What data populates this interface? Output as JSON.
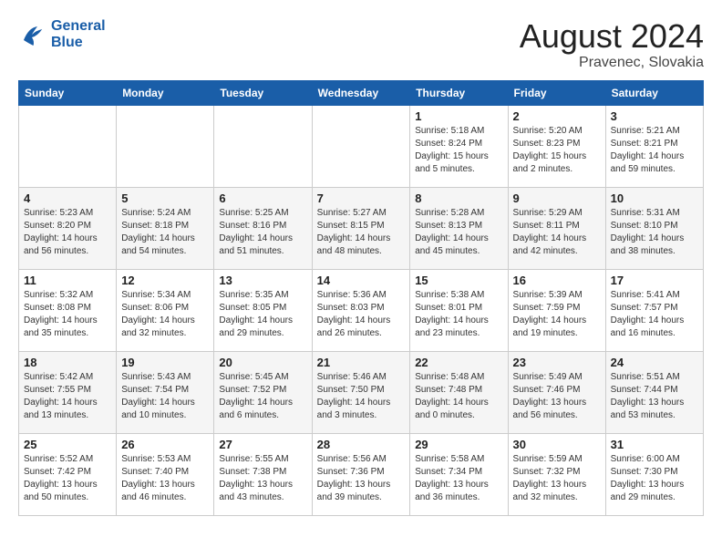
{
  "logo": {
    "line1": "General",
    "line2": "Blue"
  },
  "title": {
    "month_year": "August 2024",
    "location": "Pravenec, Slovakia"
  },
  "weekdays": [
    "Sunday",
    "Monday",
    "Tuesday",
    "Wednesday",
    "Thursday",
    "Friday",
    "Saturday"
  ],
  "weeks": [
    [
      {
        "day": "",
        "info": ""
      },
      {
        "day": "",
        "info": ""
      },
      {
        "day": "",
        "info": ""
      },
      {
        "day": "",
        "info": ""
      },
      {
        "day": "1",
        "info": "Sunrise: 5:18 AM\nSunset: 8:24 PM\nDaylight: 15 hours\nand 5 minutes."
      },
      {
        "day": "2",
        "info": "Sunrise: 5:20 AM\nSunset: 8:23 PM\nDaylight: 15 hours\nand 2 minutes."
      },
      {
        "day": "3",
        "info": "Sunrise: 5:21 AM\nSunset: 8:21 PM\nDaylight: 14 hours\nand 59 minutes."
      }
    ],
    [
      {
        "day": "4",
        "info": "Sunrise: 5:23 AM\nSunset: 8:20 PM\nDaylight: 14 hours\nand 56 minutes."
      },
      {
        "day": "5",
        "info": "Sunrise: 5:24 AM\nSunset: 8:18 PM\nDaylight: 14 hours\nand 54 minutes."
      },
      {
        "day": "6",
        "info": "Sunrise: 5:25 AM\nSunset: 8:16 PM\nDaylight: 14 hours\nand 51 minutes."
      },
      {
        "day": "7",
        "info": "Sunrise: 5:27 AM\nSunset: 8:15 PM\nDaylight: 14 hours\nand 48 minutes."
      },
      {
        "day": "8",
        "info": "Sunrise: 5:28 AM\nSunset: 8:13 PM\nDaylight: 14 hours\nand 45 minutes."
      },
      {
        "day": "9",
        "info": "Sunrise: 5:29 AM\nSunset: 8:11 PM\nDaylight: 14 hours\nand 42 minutes."
      },
      {
        "day": "10",
        "info": "Sunrise: 5:31 AM\nSunset: 8:10 PM\nDaylight: 14 hours\nand 38 minutes."
      }
    ],
    [
      {
        "day": "11",
        "info": "Sunrise: 5:32 AM\nSunset: 8:08 PM\nDaylight: 14 hours\nand 35 minutes."
      },
      {
        "day": "12",
        "info": "Sunrise: 5:34 AM\nSunset: 8:06 PM\nDaylight: 14 hours\nand 32 minutes."
      },
      {
        "day": "13",
        "info": "Sunrise: 5:35 AM\nSunset: 8:05 PM\nDaylight: 14 hours\nand 29 minutes."
      },
      {
        "day": "14",
        "info": "Sunrise: 5:36 AM\nSunset: 8:03 PM\nDaylight: 14 hours\nand 26 minutes."
      },
      {
        "day": "15",
        "info": "Sunrise: 5:38 AM\nSunset: 8:01 PM\nDaylight: 14 hours\nand 23 minutes."
      },
      {
        "day": "16",
        "info": "Sunrise: 5:39 AM\nSunset: 7:59 PM\nDaylight: 14 hours\nand 19 minutes."
      },
      {
        "day": "17",
        "info": "Sunrise: 5:41 AM\nSunset: 7:57 PM\nDaylight: 14 hours\nand 16 minutes."
      }
    ],
    [
      {
        "day": "18",
        "info": "Sunrise: 5:42 AM\nSunset: 7:55 PM\nDaylight: 14 hours\nand 13 minutes."
      },
      {
        "day": "19",
        "info": "Sunrise: 5:43 AM\nSunset: 7:54 PM\nDaylight: 14 hours\nand 10 minutes."
      },
      {
        "day": "20",
        "info": "Sunrise: 5:45 AM\nSunset: 7:52 PM\nDaylight: 14 hours\nand 6 minutes."
      },
      {
        "day": "21",
        "info": "Sunrise: 5:46 AM\nSunset: 7:50 PM\nDaylight: 14 hours\nand 3 minutes."
      },
      {
        "day": "22",
        "info": "Sunrise: 5:48 AM\nSunset: 7:48 PM\nDaylight: 14 hours\nand 0 minutes."
      },
      {
        "day": "23",
        "info": "Sunrise: 5:49 AM\nSunset: 7:46 PM\nDaylight: 13 hours\nand 56 minutes."
      },
      {
        "day": "24",
        "info": "Sunrise: 5:51 AM\nSunset: 7:44 PM\nDaylight: 13 hours\nand 53 minutes."
      }
    ],
    [
      {
        "day": "25",
        "info": "Sunrise: 5:52 AM\nSunset: 7:42 PM\nDaylight: 13 hours\nand 50 minutes."
      },
      {
        "day": "26",
        "info": "Sunrise: 5:53 AM\nSunset: 7:40 PM\nDaylight: 13 hours\nand 46 minutes."
      },
      {
        "day": "27",
        "info": "Sunrise: 5:55 AM\nSunset: 7:38 PM\nDaylight: 13 hours\nand 43 minutes."
      },
      {
        "day": "28",
        "info": "Sunrise: 5:56 AM\nSunset: 7:36 PM\nDaylight: 13 hours\nand 39 minutes."
      },
      {
        "day": "29",
        "info": "Sunrise: 5:58 AM\nSunset: 7:34 PM\nDaylight: 13 hours\nand 36 minutes."
      },
      {
        "day": "30",
        "info": "Sunrise: 5:59 AM\nSunset: 7:32 PM\nDaylight: 13 hours\nand 32 minutes."
      },
      {
        "day": "31",
        "info": "Sunrise: 6:00 AM\nSunset: 7:30 PM\nDaylight: 13 hours\nand 29 minutes."
      }
    ]
  ]
}
